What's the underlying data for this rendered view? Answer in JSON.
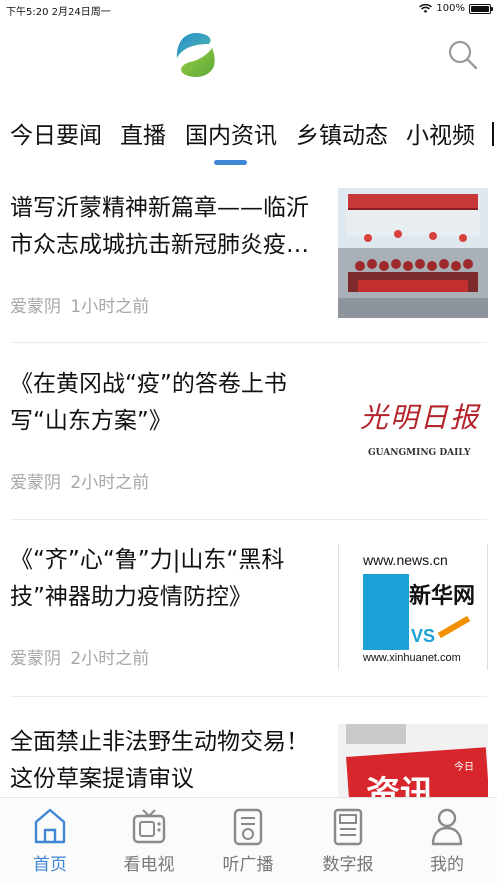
{
  "status_bar": {
    "time_date": "下午5:20   2月24日周一",
    "battery": "100%",
    "battery_level": 1.0
  },
  "header": {
    "logo_icon": "leaf-logo-icon",
    "search_icon": "search-icon"
  },
  "tabs": [
    {
      "label": "今日要闻",
      "active": false
    },
    {
      "label": "直播",
      "active": false
    },
    {
      "label": "国内资讯",
      "active": true
    },
    {
      "label": "乡镇动态",
      "active": false
    },
    {
      "label": "小视频",
      "active": false
    }
  ],
  "news": [
    {
      "title": "谱写沂蒙精神新篇章——临沂市众志成城抗击新冠肺炎疫…",
      "source": "爱蒙阴",
      "time": "1小时之前",
      "thumb": "photo-group-thumbnail"
    },
    {
      "title": "《在黄冈战“疫”的答卷上书写“山东方案”》",
      "source": "爱蒙阴",
      "time": "2小时之前",
      "thumb": "guangming-daily-logo",
      "thumb_text": {
        "cn": "光明日报",
        "en": "GUANGMING DAILY"
      }
    },
    {
      "title": "《“齐”心“鲁”力|山东“黑科技”神器助力疫情防控》",
      "source": "爱蒙阴",
      "time": "2小时之前",
      "thumb": "xinhua-logo",
      "thumb_text": {
        "top": "www.news.cn",
        "cn": "新华网",
        "vs": "VS",
        "bottom": "www.xinhuanet.com"
      }
    },
    {
      "title": "全面禁止非法野生动物交易！这份草案提请审议",
      "source": "",
      "time": "",
      "thumb": "zixun-news-thumbnail",
      "thumb_text": {
        "tag": "今日",
        "big": "资讯"
      }
    }
  ],
  "bottom_nav": [
    {
      "label": "首页",
      "icon": "home-icon",
      "active": true
    },
    {
      "label": "看电视",
      "icon": "tv-icon",
      "active": false
    },
    {
      "label": "听广播",
      "icon": "radio-icon",
      "active": false
    },
    {
      "label": "数字报",
      "icon": "newspaper-icon",
      "active": false
    },
    {
      "label": "我的",
      "icon": "user-icon",
      "active": false
    }
  ],
  "colors": {
    "accent": "#3f86d4",
    "meta_text": "#a7a7a7",
    "guangming_red": "#b3232a",
    "xinhua_blue": "#1ba0d8",
    "xinhua_orange": "#f29100",
    "zixun_red": "#d7262c"
  }
}
